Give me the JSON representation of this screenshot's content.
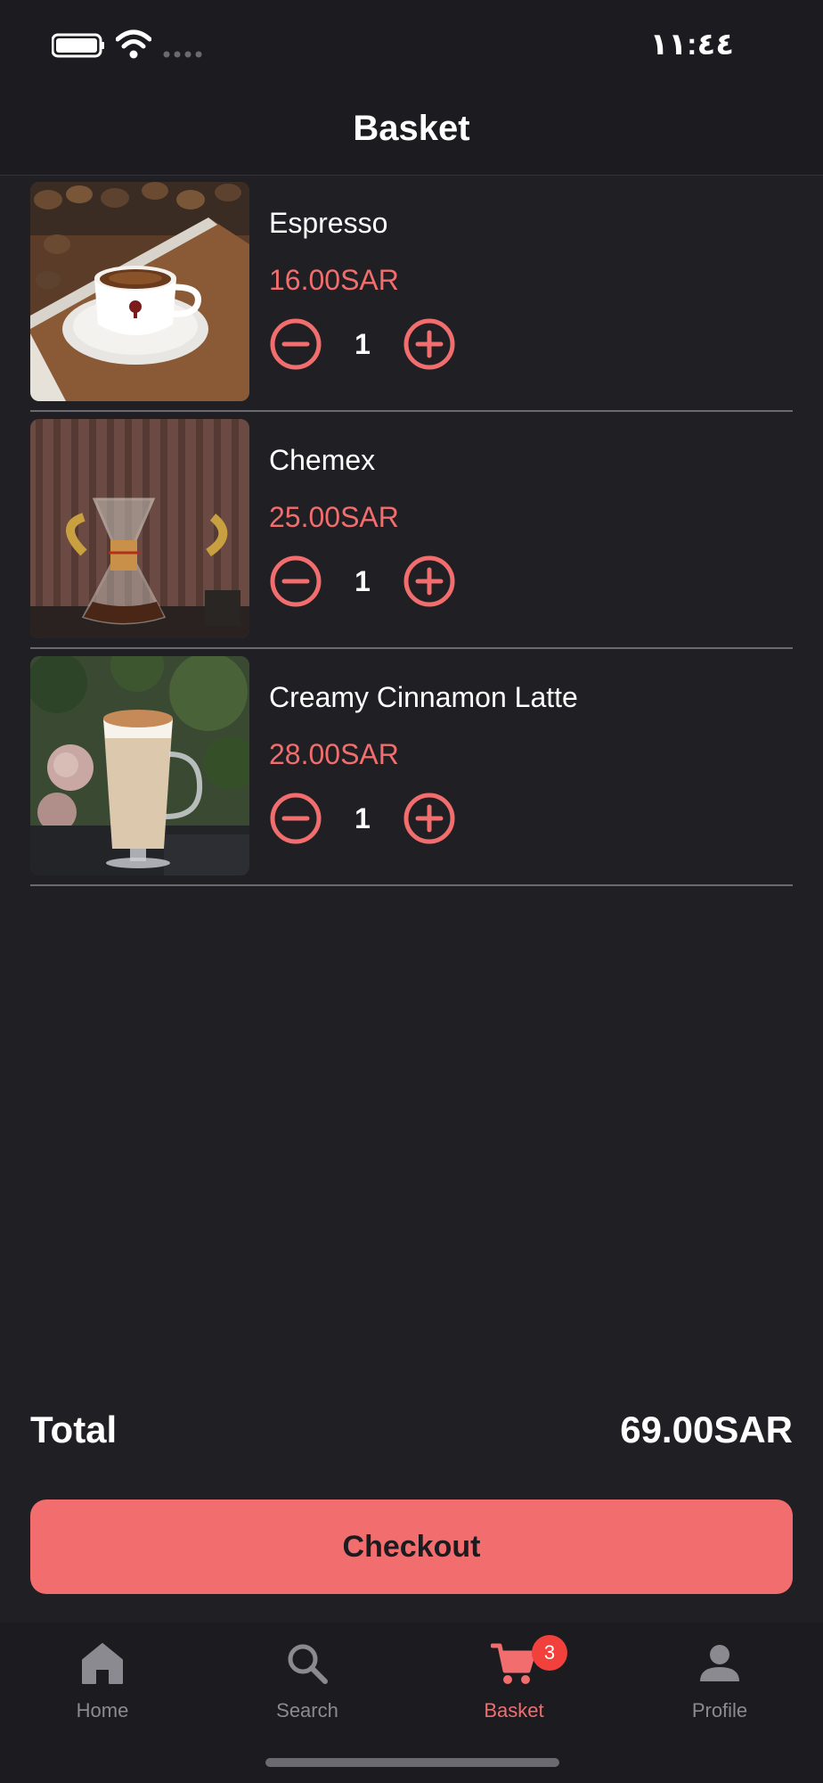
{
  "status_bar": {
    "time": "١١:٤٤",
    "battery_icon": "battery-icon",
    "wifi_icon": "wifi-icon",
    "signal_icon": "signal-dots-icon"
  },
  "header": {
    "title": "Basket"
  },
  "basket": {
    "items": [
      {
        "name": "Espresso",
        "price": "16.00SAR",
        "quantity": "1",
        "image": "espresso-photo"
      },
      {
        "name": "Chemex",
        "price": "25.00SAR",
        "quantity": "1",
        "image": "chemex-photo"
      },
      {
        "name": "Creamy Cinnamon Latte",
        "price": "28.00SAR",
        "quantity": "1",
        "image": "latte-photo"
      }
    ],
    "minus_icon": "minus-circle-icon",
    "plus_icon": "plus-circle-icon"
  },
  "summary": {
    "total_label": "Total",
    "total_value": "69.00SAR",
    "checkout_label": "Checkout"
  },
  "nav": {
    "items": [
      {
        "label": "Home",
        "icon": "home-icon",
        "active": false
      },
      {
        "label": "Search",
        "icon": "search-icon",
        "active": false
      },
      {
        "label": "Basket",
        "icon": "cart-icon",
        "active": true,
        "badge": "3"
      },
      {
        "label": "Profile",
        "icon": "person-icon",
        "active": false
      }
    ]
  },
  "colors": {
    "background": "#202024",
    "bar_background": "#1c1c20",
    "accent": "#f26d6d",
    "badge": "#f2413c",
    "text": "#ffffff",
    "muted": "#8a8a90"
  }
}
